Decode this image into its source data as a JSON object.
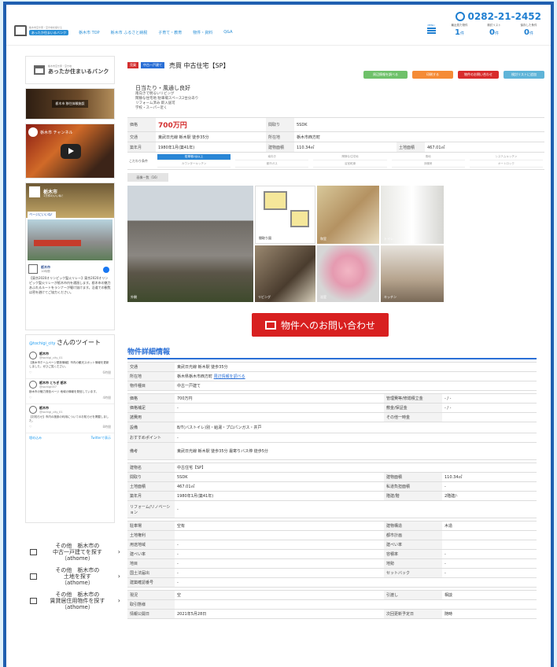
{
  "header": {
    "logo_small": "栃木市空き家・空き地を探せる",
    "logo_band": "あったか住まいるバンク",
    "nav": [
      "栃木市 TOP",
      "栃木市 ふるさと納税",
      "子育て・教育",
      "物件・資料",
      "Q&A"
    ],
    "phone": "0282-21-2452",
    "menu_label": "MENU",
    "counters": [
      {
        "label": "最近見た物件",
        "value": "1",
        "unit": "件"
      },
      {
        "label": "検討リスト",
        "value": "0",
        "unit": "件"
      },
      {
        "label": "保存した条件",
        "value": "0",
        "unit": "件"
      }
    ]
  },
  "sidebar": {
    "logo_small": "栃木市空き家・空き地",
    "logo_name": "あったか住まいるバンク",
    "banner_text": "栃木市 移住体験施設",
    "video_title": "栃木市 チャンネル",
    "fb": {
      "page_name": "栃木市",
      "page_sub": "1万件のいいね！",
      "like": "ページにいいね！",
      "post_name": "栃木市",
      "post_sub": "10時間",
      "text": "【東京2020オリンピック聖火リレー】東京2020オリンピック聖火リレーが栃木市内を通過します。栃木市の魅力あふれるルートをランナーが駆け抜けます。沿道での観覧は密を避けてご協力ください。"
    },
    "twitter": {
      "head_prefix": "@tochigi_city",
      "head_suffix": "さんのツイート",
      "tweets": [
        {
          "name": "栃木市",
          "handle": "@tochigi_city_01",
          "text": "【栃木市ホームページ更新情報】市内の観光スポット情報を更新しました。ぜひご覧ください。",
          "time": "6時間"
        },
        {
          "name": "栃木市 とちぎ 栃木",
          "handle": "@tochigi007",
          "text": "栃木市の魅力発信ページ 地域の情報を発信しています。",
          "time": "4時間"
        },
        {
          "name": "栃木市",
          "handle": "@tochigi_city_01",
          "text": "【お知らせ】市内の施設の利用についてのお知らせを掲載しました。",
          "time": "8時間"
        }
      ],
      "embed": "埋め込み",
      "view_on": "Twitterで表示"
    },
    "links": [
      {
        "text": "その他　栃木市の\n中古一戸建てを探す\n（athome）"
      },
      {
        "text": "その他　栃木市の\n土地を探す\n（athome）"
      },
      {
        "text": "その他　栃木市の\n賃貸居住用物件を探す\n（athome）"
      }
    ]
  },
  "property": {
    "tag1": "売買",
    "tag2": "中古一戸建て",
    "title": "売買 中古住宅【SP】",
    "buttons": [
      "周辺情報を調べる",
      "印刷する",
      "物件のお問い合わせ",
      "検討リストに追加"
    ],
    "catch_title": "日当たり・風通し良好",
    "catch_lines": [
      "南向きで明るいリビング",
      "閑静な住宅地 駐車場スペース2台分あり",
      "リフォーム済み 即入居可",
      "学校・スーパー近く"
    ],
    "price_label": "価格",
    "price": "700万円",
    "layout_label": "間取り",
    "layout": "5SDK",
    "addr_label": "交通",
    "addr": "東武日光線 栃木駅 徒歩35分",
    "loc_label": "所在地",
    "loc": "栃木市西方町",
    "built_label": "築年月",
    "built": "1980年1月(築41年)",
    "bldg_label": "建物面積",
    "bldg": "110.34㎡",
    "land_label": "土地面積",
    "land": "467.01㎡",
    "filters_label": "こだわり条件",
    "filters": [
      "駐車場2台以上",
      "南向き",
      "閑静な住宅地",
      "角地",
      "システムキッチン",
      "カウンターキッチン",
      "都市ガス",
      "浴室乾燥",
      "床暖房",
      "オートロック"
    ],
    "gallery_tab": "画像一覧（16）",
    "captions": [
      "外観",
      "間取り図",
      "和室",
      "トイレ",
      "リビング",
      "浴室",
      "キッチン"
    ],
    "inquiry": "物件へのお問い合わせ"
  },
  "details": {
    "title": "物件詳細情報",
    "rows1": [
      {
        "label": "交通",
        "value": "東武日光線 栃木駅 徒歩35分"
      },
      {
        "label": "所在地",
        "value": "栃木県栃木市西方町",
        "link": "周辺情報を調べる"
      },
      {
        "label": "物件種目",
        "value": "中古一戸建て"
      }
    ],
    "rows2": [
      [
        "価格",
        "700万円",
        "管理費等/修繕積立金",
        "- / -"
      ],
      [
        "価格補足",
        "-",
        "敷金/保証金",
        "- / -"
      ],
      [
        "諸費用",
        "",
        "その他一時金",
        ""
      ]
    ],
    "equip_label": "設備",
    "equip": "B/T(バストイレ)別・給湯・プロパンガス・井戸",
    "point_label": "おすすめポイント",
    "point": "-",
    "note_label": "備考",
    "note": "東武日光線 栃木駅 徒歩35分 最寄りバス停 徒歩5分",
    "rows3": [
      [
        "建物名",
        "中古住宅【SP】",
        "",
        ""
      ],
      [
        "間取り",
        "5SDK",
        "建物面積",
        "110.34㎡"
      ],
      [
        "土地面積",
        "467.01㎡",
        "私道負担面積",
        "-"
      ],
      [
        "築年月",
        "1980年1月(築41年)",
        "階建/階",
        "2階建/-"
      ]
    ],
    "reform_label": "リフォーム/リノベーション",
    "reform": "-",
    "rows4": [
      [
        "駐車場",
        "空有",
        "建物構造",
        "木造"
      ],
      [
        "土地権利",
        "",
        "都市計画",
        ""
      ],
      [
        "用途地域",
        "-",
        "建ぺい率",
        ""
      ],
      [
        "建ぺい率",
        "-",
        "容積率",
        "-"
      ],
      [
        "地目",
        "-",
        "地勢",
        "-"
      ],
      [
        "国土法届出",
        "-",
        "セットバック",
        "-"
      ],
      [
        "建築確認番号",
        "-",
        "",
        ""
      ]
    ],
    "rows5": [
      [
        "現況",
        "空",
        "引渡し",
        "相談"
      ],
      [
        "取引態様",
        "",
        "",
        ""
      ],
      [
        "情報公開日",
        "2021年5月28日",
        "次回更新予定日",
        "随時"
      ]
    ]
  },
  "colors": {
    "accent": "#2a6fd6",
    "price": "#d32f2f",
    "frame": "#1f5fb0",
    "cta": "#d82020"
  }
}
